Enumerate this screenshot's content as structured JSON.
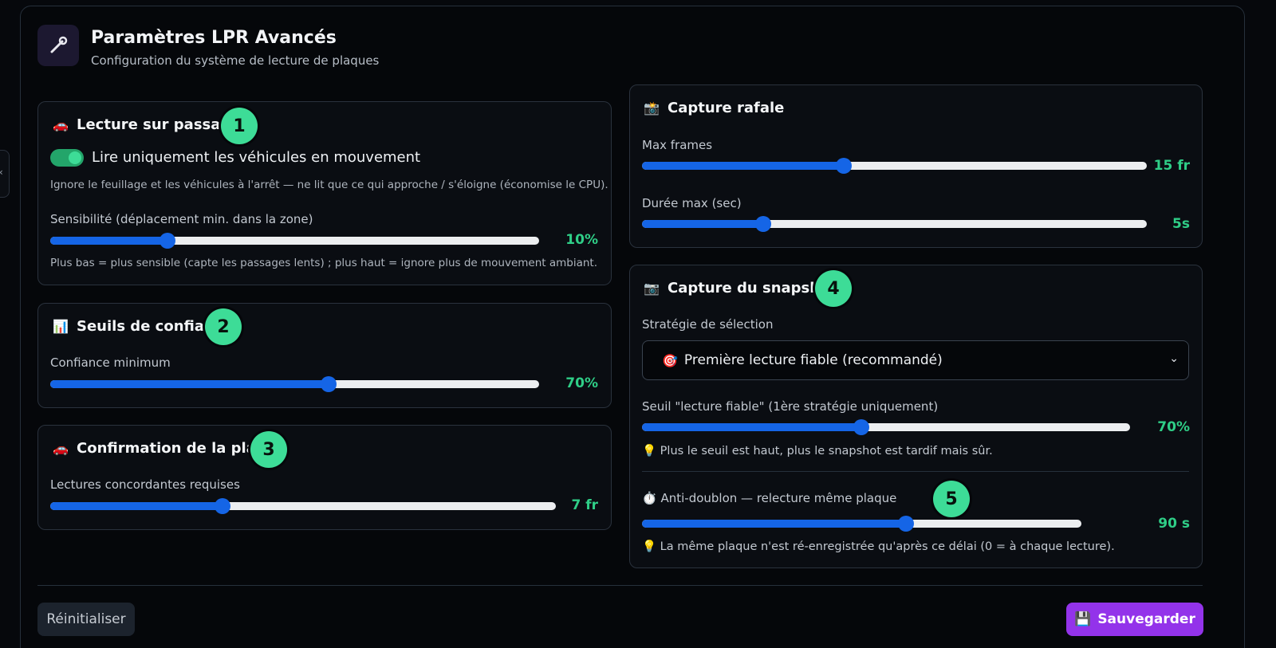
{
  "header": {
    "title": "Paramètres LPR Avancés",
    "subtitle": "Configuration du système de lecture de plaques",
    "icon": "wrench-icon"
  },
  "passage": {
    "emoji": "🚗",
    "title": "Lecture sur passage",
    "badge": "1",
    "toggle_on": true,
    "toggle_label": "Lire uniquement les véhicules en mouvement",
    "toggle_help": "Ignore le feuillage et les véhicules à l'arrêt — ne lit que ce qui approche / s'éloigne (économise le CPU).",
    "sensitivity_label": "Sensibilité (déplacement min. dans la zone)",
    "sensitivity_value": "10%",
    "sensitivity_level": 0.24,
    "sensitivity_help": "Plus bas = plus sensible (capte les passages lents) ; plus haut = ignore plus de mouvement ambiant."
  },
  "confidence": {
    "emoji": "📊",
    "title": "Seuils de confiance",
    "badge": "2",
    "min_label": "Confiance minimum",
    "min_value": "70%",
    "min_level": 0.57
  },
  "plate": {
    "emoji": "🚗",
    "title": "Confirmation de la plaque",
    "badge": "3",
    "reads_label": "Lectures concordantes requises",
    "reads_value": "7 fr",
    "reads_level": 0.34
  },
  "burst": {
    "emoji": "📸",
    "title": "Capture rafale",
    "max_frames_label": "Max frames",
    "max_frames_value": "15 fr",
    "max_frames_level": 0.4,
    "max_duration_label": "Durée max (sec)",
    "max_duration_value": "5s",
    "max_duration_level": 0.24
  },
  "snapshot": {
    "emoji": "📷",
    "title": "Capture du snapshot",
    "badge": "4",
    "strategy_label": "Stratégie de sélection",
    "strategy_emoji": "🎯",
    "strategy_selected": "Première lecture fiable (recommandé)",
    "threshold_label": "Seuil \"lecture fiable\" (1ère stratégie uniquement)",
    "threshold_value": "70%",
    "threshold_level": 0.45,
    "threshold_help": "Plus le seuil est haut, plus le snapshot est tardif mais sûr.",
    "dedupe_emoji": "⏱️",
    "dedupe_label": "Anti-doublon — relecture même plaque",
    "dedupe_badge": "5",
    "dedupe_value": "90 s",
    "dedupe_level": 0.6,
    "dedupe_help": "La même plaque n'est ré-enregistrée qu'après ce délai (0 = à chaque lecture).",
    "bulb_emoji": "💡"
  },
  "footer": {
    "reset_label": "Réinitialiser",
    "save_emoji": "💾",
    "save_label": "Sauvegarder"
  },
  "colors": {
    "accent_green": "#2fce87",
    "slider_blue": "#1565e6",
    "save_purple": "#9333ea"
  }
}
